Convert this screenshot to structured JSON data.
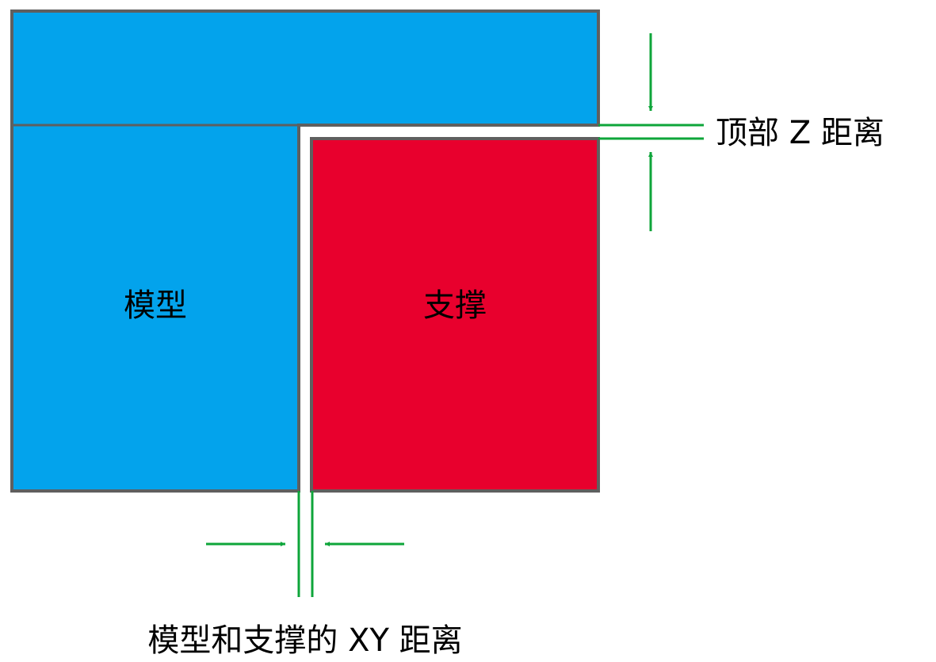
{
  "labels": {
    "model": "模型",
    "support": "支撑",
    "top_z_distance": "顶部 Z 距离",
    "xy_distance": "模型和支撑的 XY 距离"
  },
  "colors": {
    "model_fill": "#03a3ec",
    "support_fill": "#e8002d",
    "outline": "#5f5f5f",
    "dimension": "#0ea53a",
    "text": "#000000",
    "background": "#ffffff"
  }
}
